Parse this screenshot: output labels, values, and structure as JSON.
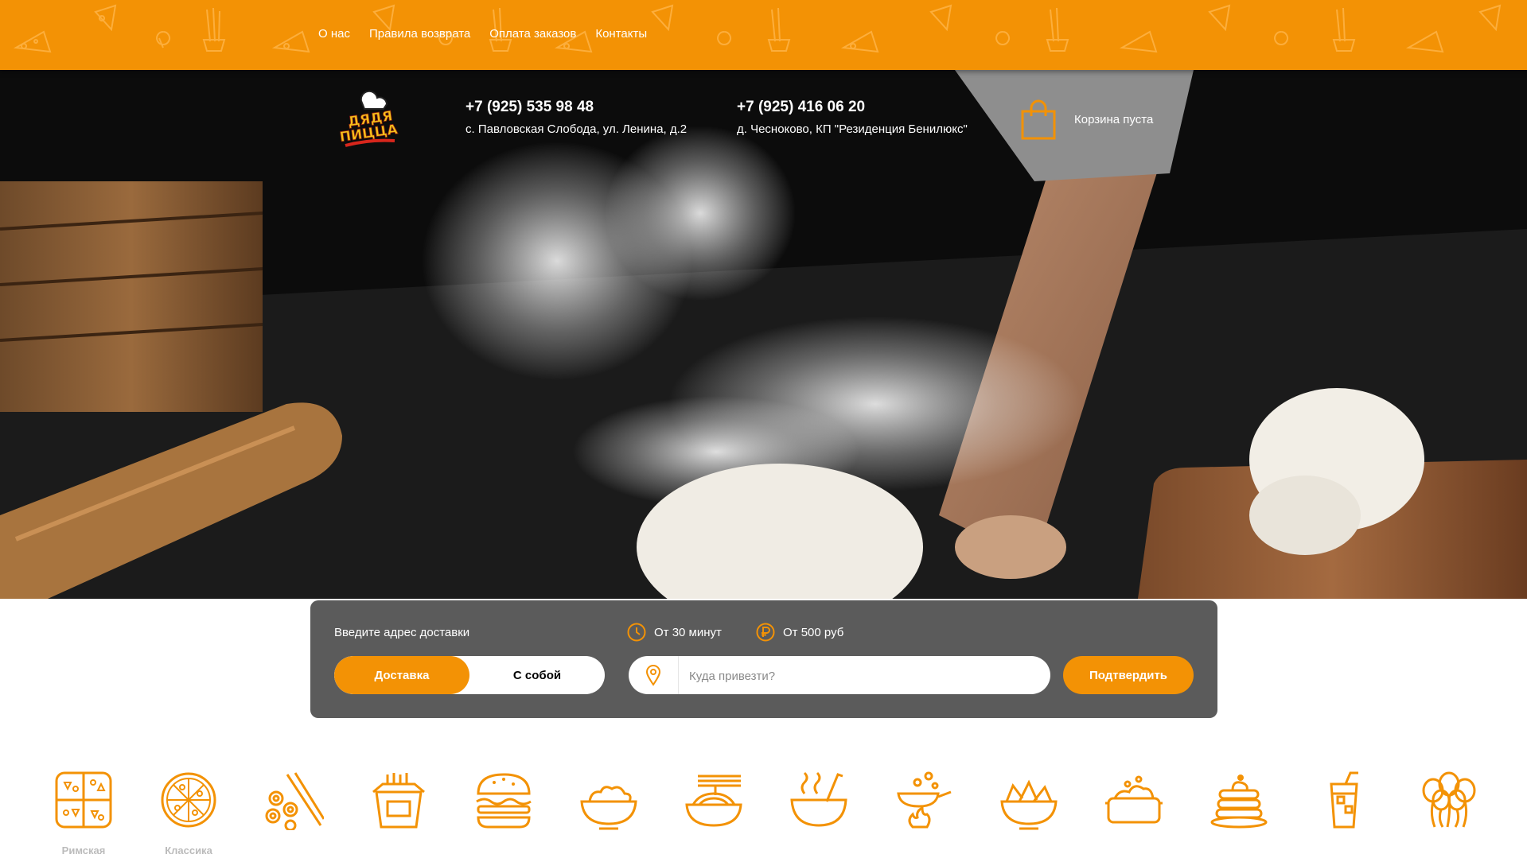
{
  "nav": {
    "links": [
      "О нас",
      "Правила возврата",
      "Оплата заказов",
      "Контакты"
    ]
  },
  "logo": {
    "line1": "ДЯДЯ",
    "line2": "ПИЦЦА"
  },
  "contacts": [
    {
      "phone": "+7 (925) 535 98 48",
      "address": "с. Павловская Слобода, ул. Ленина, д.2"
    },
    {
      "phone": "+7 (925) 416 06 20",
      "address": "д. Чесноково, КП \"Резиденция Бенилюкс\""
    }
  ],
  "cart": {
    "label": "Корзина пуста"
  },
  "delivery": {
    "prompt": "Введите адрес доставки",
    "mode_delivery": "Доставка",
    "mode_pickup": "С собой",
    "time_info": "От 30 минут",
    "price_info": "От 500 руб",
    "address_placeholder": "Куда привезти?",
    "confirm_label": "Подтвердить"
  },
  "categories": [
    {
      "icon": "roman-pizza-icon",
      "label": "Римская"
    },
    {
      "icon": "classic-pizza-icon",
      "label": "Классика"
    },
    {
      "icon": "sushi-icon",
      "label": ""
    },
    {
      "icon": "noodle-box-icon",
      "label": ""
    },
    {
      "icon": "burger-icon",
      "label": ""
    },
    {
      "icon": "salad-bowl-icon",
      "label": ""
    },
    {
      "icon": "pasta-icon",
      "label": ""
    },
    {
      "icon": "soup-icon",
      "label": ""
    },
    {
      "icon": "wok-icon",
      "label": ""
    },
    {
      "icon": "nachos-icon",
      "label": ""
    },
    {
      "icon": "hot-dish-icon",
      "label": ""
    },
    {
      "icon": "pancakes-icon",
      "label": ""
    },
    {
      "icon": "drink-icon",
      "label": ""
    },
    {
      "icon": "balloons-icon",
      "label": ""
    }
  ],
  "colors": {
    "accent": "#f39205",
    "panel": "#5b5b5b"
  }
}
